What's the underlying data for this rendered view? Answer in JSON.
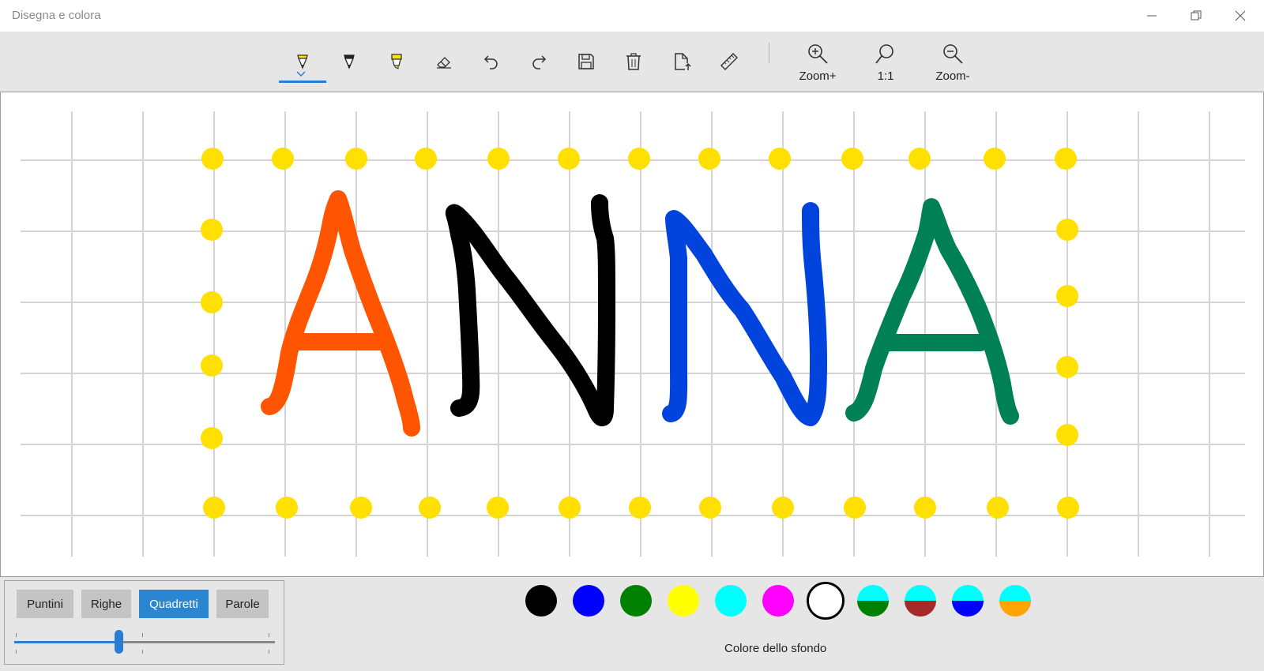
{
  "app": {
    "title": "Disegna e colora"
  },
  "window_controls": [
    "minimize-icon",
    "restore-icon",
    "close-icon"
  ],
  "toolbar": {
    "tools": [
      {
        "name": "pen-tool",
        "icon": "pen-yellow-icon",
        "selected": true
      },
      {
        "name": "marker-tool",
        "icon": "pen-black-icon"
      },
      {
        "name": "highlighter-tool",
        "icon": "highlighter-icon"
      },
      {
        "name": "eraser-tool",
        "icon": "eraser-icon"
      },
      {
        "name": "undo-tool",
        "icon": "undo-icon"
      },
      {
        "name": "redo-tool",
        "icon": "redo-icon"
      },
      {
        "name": "save-tool",
        "icon": "save-icon"
      },
      {
        "name": "delete-tool",
        "icon": "trash-icon"
      },
      {
        "name": "export-tool",
        "icon": "export-icon"
      },
      {
        "name": "ruler-tool",
        "icon": "ruler-icon"
      }
    ],
    "zoom_in_label": "Zoom+",
    "zoom_reset_label": "1:1",
    "zoom_out_label": "Zoom-"
  },
  "drawing": {
    "letters": [
      "A",
      "N",
      "N",
      "A"
    ],
    "letter_colors": [
      "#ff5500",
      "#000000",
      "#0044dd",
      "#008055"
    ],
    "grid": "quadretti",
    "dot_color": "#ffe000"
  },
  "grid_panel": {
    "buttons": [
      {
        "label": "Puntini",
        "active": false
      },
      {
        "label": "Righe",
        "active": false
      },
      {
        "label": "Quadretti",
        "active": true
      },
      {
        "label": "Parole",
        "active": false
      }
    ],
    "slider_value": 0.4
  },
  "palette": {
    "colors": [
      {
        "top": "#000000",
        "bottom": "#000000"
      },
      {
        "top": "#0000ff",
        "bottom": "#0000ff"
      },
      {
        "top": "#008000",
        "bottom": "#008000"
      },
      {
        "top": "#ffff00",
        "bottom": "#ffff00"
      },
      {
        "top": "#00ffff",
        "bottom": "#00ffff"
      },
      {
        "top": "#ff00ff",
        "bottom": "#ff00ff"
      },
      {
        "top": "#ffffff",
        "bottom": "#ffffff",
        "selected": true
      },
      {
        "top": "#00ffff",
        "bottom": "#008000"
      },
      {
        "top": "#00ffff",
        "bottom": "#a52a2a"
      },
      {
        "top": "#00ffff",
        "bottom": "#0000ff"
      },
      {
        "top": "#00ffff",
        "bottom": "#ffa500"
      }
    ],
    "background_label": "Colore dello sfondo"
  }
}
